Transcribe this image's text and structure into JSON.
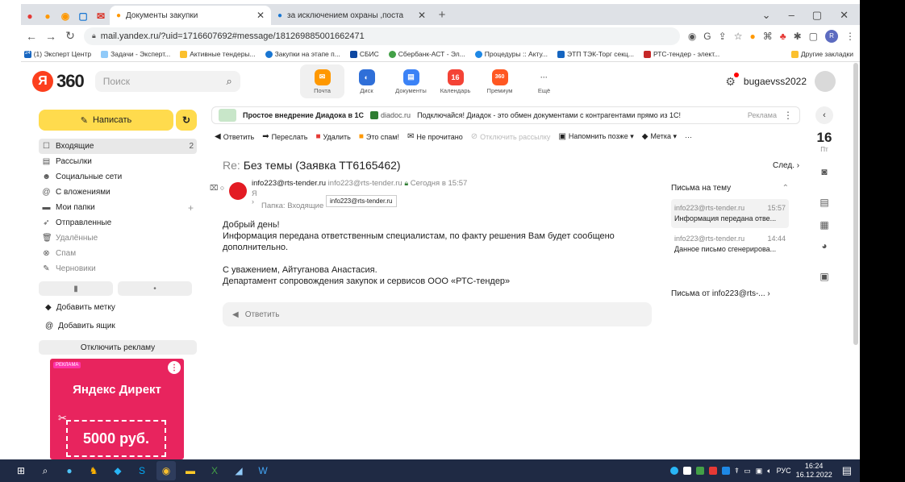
{
  "browser": {
    "tabs": [
      {
        "title": "Документы закупки",
        "active": true
      },
      {
        "title": "за исключением охраны ,поста",
        "active": false
      }
    ],
    "url": "mail.yandex.ru/?uid=1716607692#message/181269885001662471",
    "bookmarks": [
      "(1) Эксперт Центр",
      "Задачи - Эксперт...",
      "Активные тендеры...",
      "Закупки на этапе п...",
      "СБИС",
      "Сбербанк-АСТ - Эл...",
      "Процедуры :: Акту...",
      "ЭТП ТЭК-Торг секц...",
      "РТС-тендер - элект..."
    ],
    "other_bookmarks": "Другие закладки",
    "profile_initial": "R"
  },
  "header": {
    "logo_text": "360",
    "search_placeholder": "Поиск",
    "services": [
      {
        "label": "Почта",
        "icon": "mail-icon",
        "color": "#ff9800"
      },
      {
        "label": "Диск",
        "icon": "disk-icon",
        "color": "#2f6fd8"
      },
      {
        "label": "Документы",
        "icon": "documents-icon",
        "color": "#3b82f6"
      },
      {
        "label": "Календарь",
        "icon": "calendar-icon",
        "color": "#f44336",
        "badge": "16"
      },
      {
        "label": "Премиум",
        "icon": "premium-icon",
        "color": "#ff5722",
        "badge": "360"
      },
      {
        "label": "Ещё",
        "icon": "more-icon",
        "color": "#ffffff",
        "badge": "···"
      }
    ],
    "username": "bugaevss2022"
  },
  "sidebar": {
    "compose_label": "Написать",
    "folders": [
      {
        "label": "Входящие",
        "count": "2",
        "icon": "inbox-icon",
        "selected": true
      },
      {
        "label": "Рассылки",
        "count": "",
        "icon": "newsletter-icon"
      },
      {
        "label": "Социальные сети",
        "count": "",
        "icon": "social-icon"
      },
      {
        "label": "С вложениями",
        "count": "",
        "icon": "attachment-icon"
      },
      {
        "label": "Мои папки",
        "count": "+",
        "icon": "folder-icon"
      },
      {
        "label": "Отправленные",
        "count": "",
        "icon": "sent-icon"
      },
      {
        "label": "Удалённые",
        "count": "",
        "icon": "trash-icon",
        "dim": true
      },
      {
        "label": "Спам",
        "count": "",
        "icon": "spam-icon",
        "dim": true
      },
      {
        "label": "Черновики",
        "count": "",
        "icon": "draft-icon",
        "dim": true
      }
    ],
    "add_label": "Добавить метку",
    "add_mailbox": "Добавить ящик",
    "disable_ads": "Отключить рекламу",
    "ad": {
      "tag": "РЕКЛАМА",
      "title": "Яндекс Директ",
      "amount": "5000 руб."
    }
  },
  "ad_line": {
    "title": "Простое внедрение Диадока в 1С",
    "domain": "diadoc.ru",
    "text": "Подключайся! Диадок - это обмен документами с контрагентами прямо из 1С!",
    "tag": "Реклама"
  },
  "toolbar": {
    "items": [
      {
        "label": "Ответить",
        "icon": "reply-icon"
      },
      {
        "label": "Переслать",
        "icon": "forward-icon"
      },
      {
        "label": "Удалить",
        "icon": "delete-icon"
      },
      {
        "label": "Это спам!",
        "icon": "spam-icon"
      },
      {
        "label": "Не прочитано",
        "icon": "unread-icon"
      },
      {
        "label": "Отключить рассылку",
        "icon": "unsubscribe-icon",
        "disabled": true
      },
      {
        "label": "Напомнить позже ▾",
        "icon": "remind-icon"
      },
      {
        "label": "Метка ▾",
        "icon": "label-icon"
      },
      {
        "label": "···",
        "icon": "more-icon"
      }
    ]
  },
  "message": {
    "subject_prefix": "Re:",
    "subject": "Без темы (Заявка ТТ6165462)",
    "next_label": "След.",
    "sender_name": "info223@rts-tender.ru",
    "sender_address": "info223@rts-tender.ru",
    "date": "Сегодня в 15:57",
    "to": "Я",
    "folder_label": "Папка:",
    "folder": "Входящие",
    "tooltip": "info223@rts-tender.ru",
    "body": [
      "Добрый день!",
      "Информация передана ответственным специалистам, по факту решения Вам будет сообщено",
      "дополнительно.",
      "",
      "С уважением, Айтуганова Анастасия.",
      "Департамент сопровождения закупок и сервисов ООО «РТС-тендер»"
    ],
    "reply_placeholder": "Ответить"
  },
  "thread": {
    "title": "Письма на тему",
    "items": [
      {
        "from": "info223@rts-tender.ru",
        "time": "15:57",
        "snippet": "Информация передана отве..."
      },
      {
        "from": "info223@rts-tender.ru",
        "time": "14:44",
        "snippet": "Данное письмо сгенерирова..."
      }
    ],
    "from_link": "Письма от info223@rts-..."
  },
  "rail": {
    "day": "16",
    "weekday": "Пт"
  },
  "taskbar": {
    "lang": "РУС",
    "time": "16:24",
    "date": "16.12.2022"
  }
}
